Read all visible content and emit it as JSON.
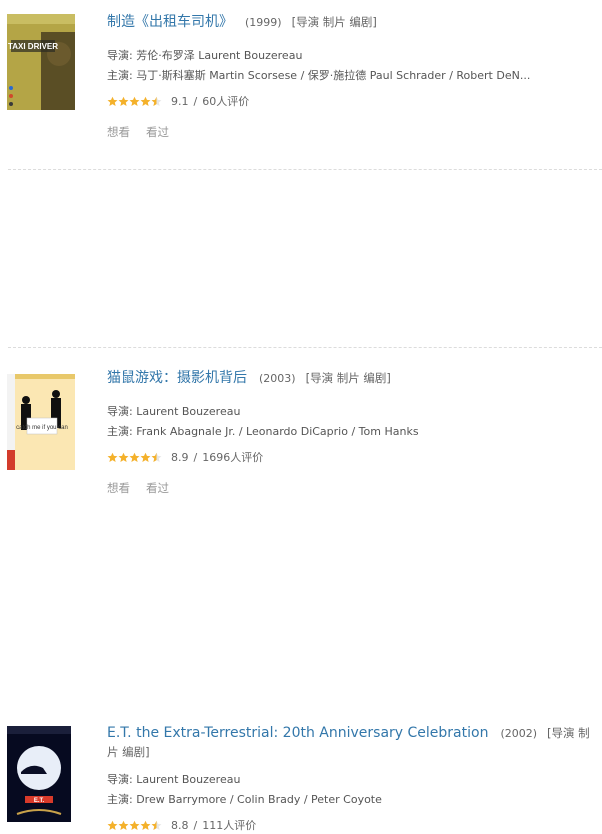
{
  "items": [
    {
      "title": "制造《出租车司机》",
      "year": "(1999)",
      "roles": "[导演 制片 编剧]",
      "director": "导演: 芳伦·布罗泽 Laurent Bouzereau",
      "cast": "主演: 马丁·斯科塞斯 Martin Scorsese / 保罗·施拉德 Paul Schrader / Robert DeN...",
      "score": "9.1",
      "sep": "/",
      "ratings": "60人评价",
      "want": "想看",
      "seen": "看过",
      "poster_text": "TAXI DRIVER",
      "stars": 4.5
    },
    {
      "title": "猫鼠游戏：摄影机背后",
      "year": "(2003)",
      "roles": "[导演 制片 编剧]",
      "director": "导演: Laurent Bouzereau",
      "cast": "主演: Frank Abagnale Jr. / Leonardo DiCaprio / Tom Hanks",
      "score": "8.9",
      "sep": "/",
      "ratings": "1696人评价",
      "want": "想看",
      "seen": "看过",
      "poster_text": "catch me if you can",
      "stars": 4.5
    },
    {
      "title": "E.T. the Extra-Terrestrial: 20th Anniversary Celebration",
      "year": "(2002)",
      "roles": "[导演 制片 编剧]",
      "director": "导演: Laurent Bouzereau",
      "cast": "主演: Drew Barrymore / Colin Brady / Peter Coyote",
      "score": "8.8",
      "sep": "/",
      "ratings": "111人评价",
      "poster_text": "E.T.",
      "stars": 4.5
    }
  ],
  "colors": {
    "link": "#3377aa",
    "star": "#f4b12b",
    "text": "#666666"
  }
}
